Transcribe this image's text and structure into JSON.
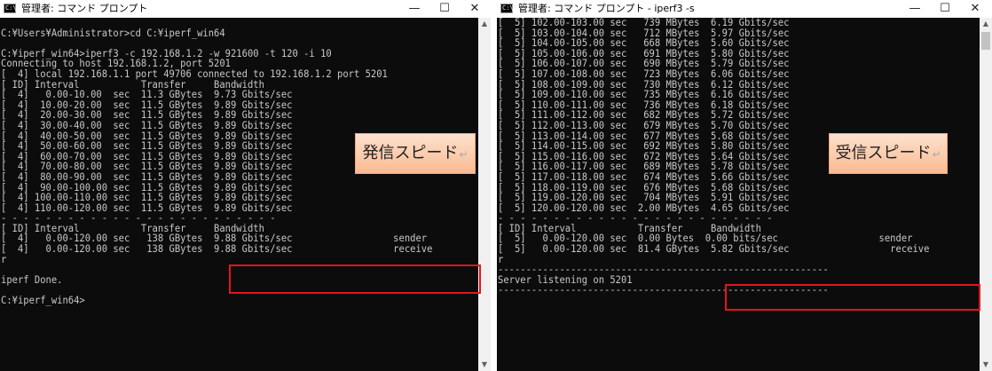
{
  "left_window": {
    "title": "管理者: コマンド プロンプト",
    "icon_label": "C:\\",
    "controls": {
      "minimize": "—",
      "maximize": "☐",
      "close": "✕"
    },
    "lines": [
      "",
      "C:¥Users¥Administrator>cd C:¥iperf_win64",
      "",
      "C:¥iperf_win64>iperf3 -c 192.168.1.2 -w 921600 -t 120 -i 10",
      "Connecting to host 192.168.1.2, port 5201",
      "[  4] local 192.168.1.1 port 49706 connected to 192.168.1.2 port 5201",
      "[ ID] Interval           Transfer     Bandwidth",
      "[  4]   0.00-10.00  sec  11.3 GBytes  9.73 Gbits/sec",
      "[  4]  10.00-20.00  sec  11.5 GBytes  9.89 Gbits/sec",
      "[  4]  20.00-30.00  sec  11.5 GBytes  9.89 Gbits/sec",
      "[  4]  30.00-40.00  sec  11.5 GBytes  9.89 Gbits/sec",
      "[  4]  40.00-50.00  sec  11.5 GBytes  9.89 Gbits/sec",
      "[  4]  50.00-60.00  sec  11.5 GBytes  9.89 Gbits/sec",
      "[  4]  60.00-70.00  sec  11.5 GBytes  9.89 Gbits/sec",
      "[  4]  70.00-80.00  sec  11.5 GBytes  9.89 Gbits/sec",
      "[  4]  80.00-90.00  sec  11.5 GBytes  9.89 Gbits/sec",
      "[  4]  90.00-100.00 sec  11.5 GBytes  9.89 Gbits/sec",
      "[  4] 100.00-110.00 sec  11.5 GBytes  9.89 Gbits/sec",
      "[  4] 110.00-120.00 sec  11.5 GBytes  9.89 Gbits/sec",
      "- - - - - - - - - - - - - - - - - - - - - - - - -",
      "[ ID] Interval           Transfer     Bandwidth",
      "[  4]   0.00-120.00 sec   138 GBytes  9.88 Gbits/sec                  sender",
      "[  4]   0.00-120.00 sec   138 GBytes  9.88 Gbits/sec                  receive",
      "r",
      "",
      "iperf Done.",
      "",
      "C:¥iperf_win64>"
    ],
    "callout": {
      "text": "発信スピード",
      "return_mark": "↵"
    }
  },
  "right_window": {
    "title": "管理者: コマンド プロンプト - iperf3  -s",
    "icon_label": "C:\\",
    "controls": {
      "minimize": "—",
      "maximize": "☐",
      "close": "✕"
    },
    "lines": [
      "[  5] 102.00-103.00 sec   739 MBytes  6.19 Gbits/sec",
      "[  5] 103.00-104.00 sec   712 MBytes  5.97 Gbits/sec",
      "[  5] 104.00-105.00 sec   668 MBytes  5.60 Gbits/sec",
      "[  5] 105.00-106.00 sec   691 MBytes  5.80 Gbits/sec",
      "[  5] 106.00-107.00 sec   690 MBytes  5.79 Gbits/sec",
      "[  5] 107.00-108.00 sec   723 MBytes  6.06 Gbits/sec",
      "[  5] 108.00-109.00 sec   730 MBytes  6.12 Gbits/sec",
      "[  5] 109.00-110.00 sec   735 MBytes  6.16 Gbits/sec",
      "[  5] 110.00-111.00 sec   736 MBytes  6.18 Gbits/sec",
      "[  5] 111.00-112.00 sec   682 MBytes  5.72 Gbits/sec",
      "[  5] 112.00-113.00 sec   679 MBytes  5.70 Gbits/sec",
      "[  5] 113.00-114.00 sec   677 MBytes  5.68 Gbits/sec",
      "[  5] 114.00-115.00 sec   692 MBytes  5.80 Gbits/sec",
      "[  5] 115.00-116.00 sec   672 MBytes  5.64 Gbits/sec",
      "[  5] 116.00-117.00 sec   689 MBytes  5.78 Gbits/sec",
      "[  5] 117.00-118.00 sec   674 MBytes  5.66 Gbits/sec",
      "[  5] 118.00-119.00 sec   676 MBytes  5.68 Gbits/sec",
      "[  5] 119.00-120.00 sec   704 MBytes  5.91 Gbits/sec",
      "[  5] 120.00-120.00 sec  2.00 MBytes  4.65 Gbits/sec",
      "- - - - - - - - - - - - - - - - - - - - - - - - -",
      "[ ID] Interval           Transfer     Bandwidth",
      "[  5]   0.00-120.00 sec  0.00 Bytes  0.00 bits/sec                  sender",
      "[  5]   0.00-120.00 sec  81.4 GBytes  5.82 Gbits/sec                  receive",
      "r",
      "-----------------------------------------------------------",
      "Server listening on 5201",
      "-----------------------------------------------------------"
    ],
    "callout": {
      "text": "受信スピード",
      "return_mark": "↵"
    }
  },
  "scrollbar": {
    "up_arrow": "▲",
    "down_arrow": "▼"
  },
  "colors": {
    "console_bg": "#0c0c0c",
    "console_text": "#c8c8c8",
    "highlight_box": "#e3161b",
    "callout_fill": "#f9ba92"
  }
}
